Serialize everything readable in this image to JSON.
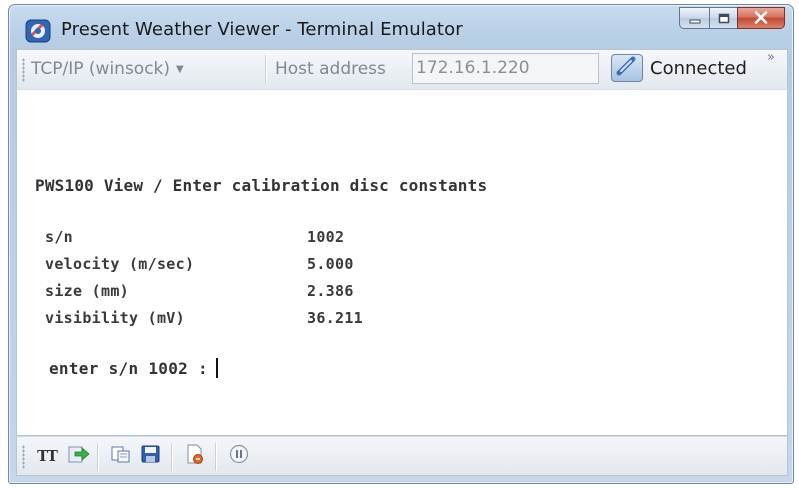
{
  "window": {
    "title": "Present Weather Viewer - Terminal Emulator"
  },
  "caption_buttons": {
    "minimize_icon": "minimize-icon",
    "maximize_icon": "maximize-icon",
    "close_icon": "close-x-icon"
  },
  "toolbar": {
    "protocol_value": "TCP/IP (winsock)",
    "host_label": "Host address",
    "host_value": "172.16.1.220",
    "status_label": "Connected",
    "overflow_glyph": "»"
  },
  "terminal": {
    "heading": "PWS100 View / Enter calibration disc constants",
    "rows": [
      {
        "label": "s/n",
        "value": "1002"
      },
      {
        "label": "velocity (m/sec)",
        "value": "5.000"
      },
      {
        "label": "size (mm)",
        "value": "2.386"
      },
      {
        "label": "visibility (mV)",
        "value": "36.211"
      }
    ],
    "prompt": "enter s/n 1002 :"
  },
  "bottom_toolbar": {
    "font_button_text": "TT",
    "icons": [
      "font-icon",
      "send-arrow-icon",
      "copy-icon",
      "save-icon",
      "new-log-icon",
      "pause-icon"
    ]
  },
  "colors": {
    "title_bar": "#c9dcef",
    "close_button": "#c24a32",
    "terminal_bg": "#ffffff"
  }
}
